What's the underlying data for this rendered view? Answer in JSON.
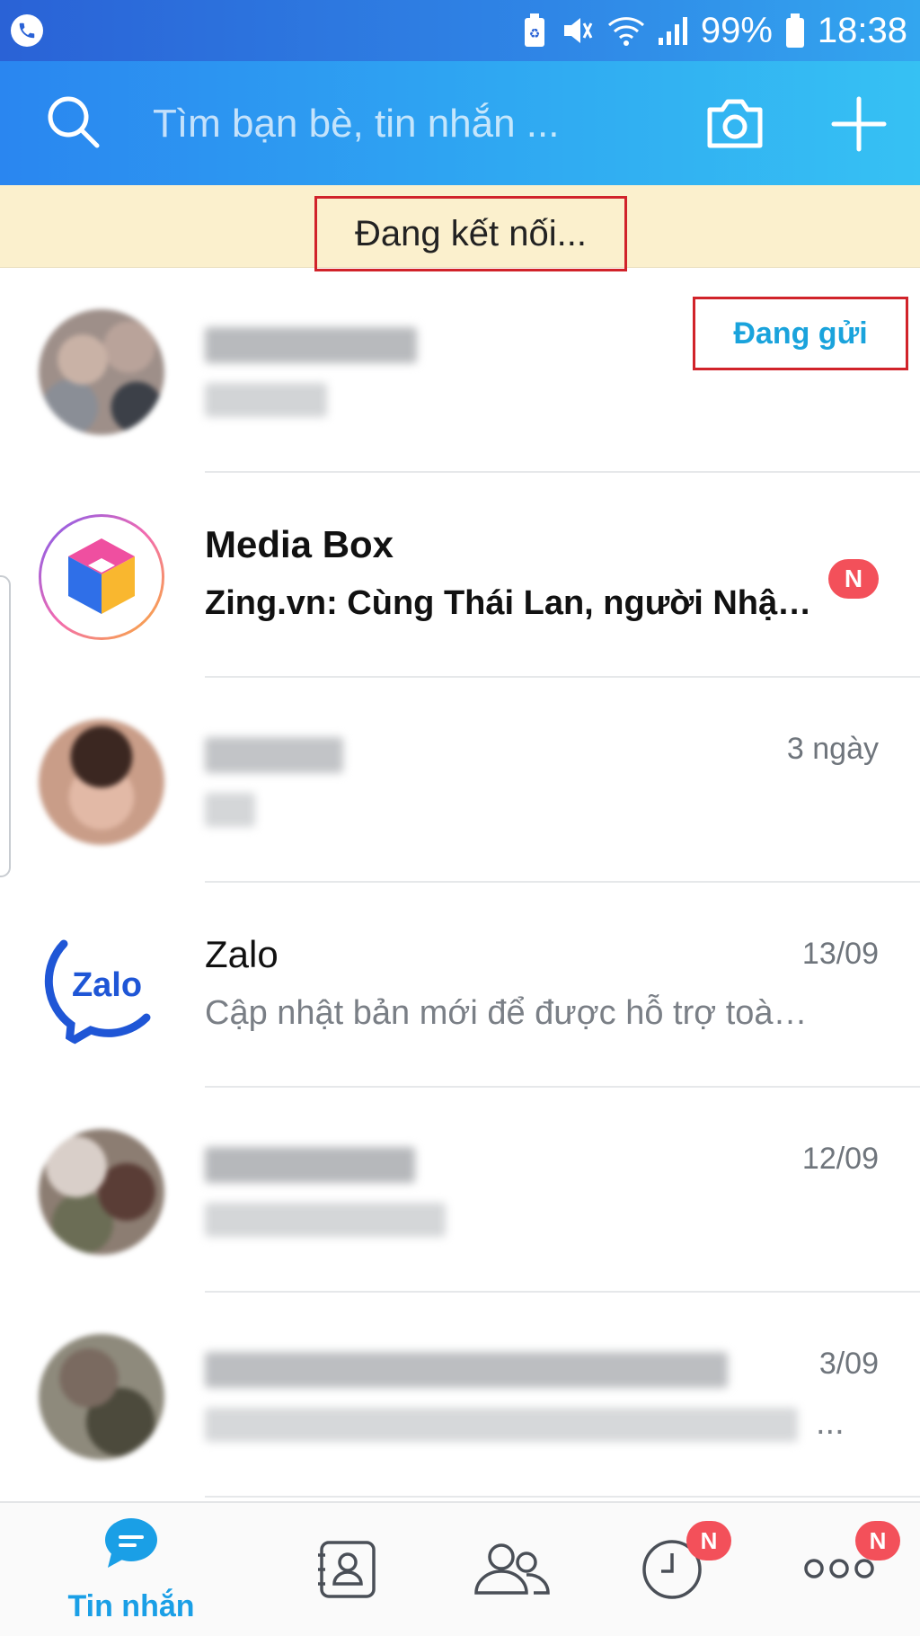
{
  "status_bar": {
    "battery": "99%",
    "time": "18:38"
  },
  "header": {
    "search_placeholder": "Tìm bạn bè, tin nhắn ..."
  },
  "banner": {
    "text": "Đang kết nối..."
  },
  "conversations": [
    {
      "name": "",
      "preview": "",
      "time": "",
      "status": "Đang gửi"
    },
    {
      "name": "Media Box",
      "preview": "Zing.vn: Cùng Thái Lan, người Nhật ...",
      "time": "",
      "badge": "N"
    },
    {
      "name": "",
      "preview": "",
      "time": "3 ngày"
    },
    {
      "name": "Zalo",
      "preview": "Cập nhật bản mới để được hỗ trợ toàn v...",
      "time": "13/09"
    },
    {
      "name": "",
      "preview": "",
      "time": "12/09"
    },
    {
      "name": "",
      "preview": "...",
      "time": "3/09"
    }
  ],
  "bottom_nav": {
    "messages_label": "Tin nhắn",
    "timeline_badge": "N",
    "more_badge": "N"
  },
  "colors": {
    "header_start": "#2a86f0",
    "header_end": "#36c1f3",
    "banner_bg": "#fbf0cd",
    "accent": "#1a9fe6",
    "badge": "#f3505a",
    "highlight_box": "#d1232a"
  }
}
